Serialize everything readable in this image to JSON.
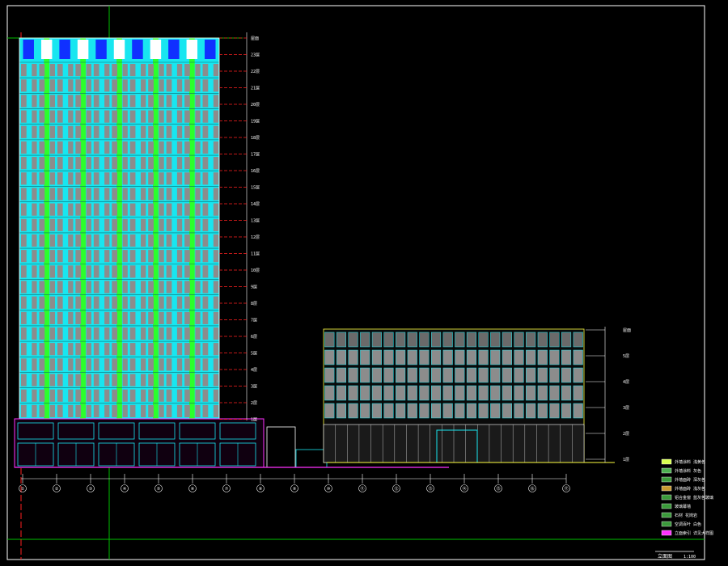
{
  "drawing": {
    "title": "立面图",
    "scale": "1:100"
  },
  "colors": {
    "background": "#000000",
    "frame": "#ffffff",
    "green_band": "#2bff2b",
    "cyan": "#18e6f0",
    "grey_wall": "#8c8c8c",
    "blue_top": "#1030ff",
    "red_dim": "#ff2020",
    "magenta": "#ff30ff",
    "yellow": "#ffff40",
    "grid_green": "#00c000"
  },
  "axis_labels": [
    "①",
    "②",
    "③",
    "④",
    "⑤",
    "⑥",
    "⑦",
    "⑧",
    "⑨",
    "⑩",
    "⑪",
    "⑫",
    "⑬",
    "⑭",
    "⑮",
    "⑯",
    "⑰"
  ],
  "tower_levels": [
    "屋面",
    "23层",
    "22层",
    "21层",
    "20层",
    "19层",
    "18层",
    "17层",
    "16层",
    "15层",
    "14层",
    "13层",
    "12层",
    "11层",
    "10层",
    "9层",
    "8层",
    "7层",
    "6层",
    "5层",
    "4层",
    "3层",
    "2层",
    "1层"
  ],
  "block_levels": [
    "屋面",
    "5层",
    "4层",
    "3层",
    "2层",
    "1层"
  ],
  "legend": [
    {
      "label": "外墙涂料 浅黄色",
      "color": "#d8ff50"
    },
    {
      "label": "外墙涂料 灰色",
      "color": "#4caf50"
    },
    {
      "label": "外墙面砖 深灰色",
      "color": "#3a9a3a"
    },
    {
      "label": "外墙面砖 浅灰色",
      "color": "#c89a30"
    },
    {
      "label": "铝合金窗 蓝灰色玻璃",
      "color": "#3a9a3a"
    },
    {
      "label": "玻璃幕墙",
      "color": "#3a9a3a"
    },
    {
      "label": "石材 花岗岩",
      "color": "#3a9a3a"
    },
    {
      "label": "空调百叶 白色",
      "color": "#3a9a3a"
    },
    {
      "label": "立面索引 详见大样图",
      "color": "#ff30ff"
    }
  ]
}
